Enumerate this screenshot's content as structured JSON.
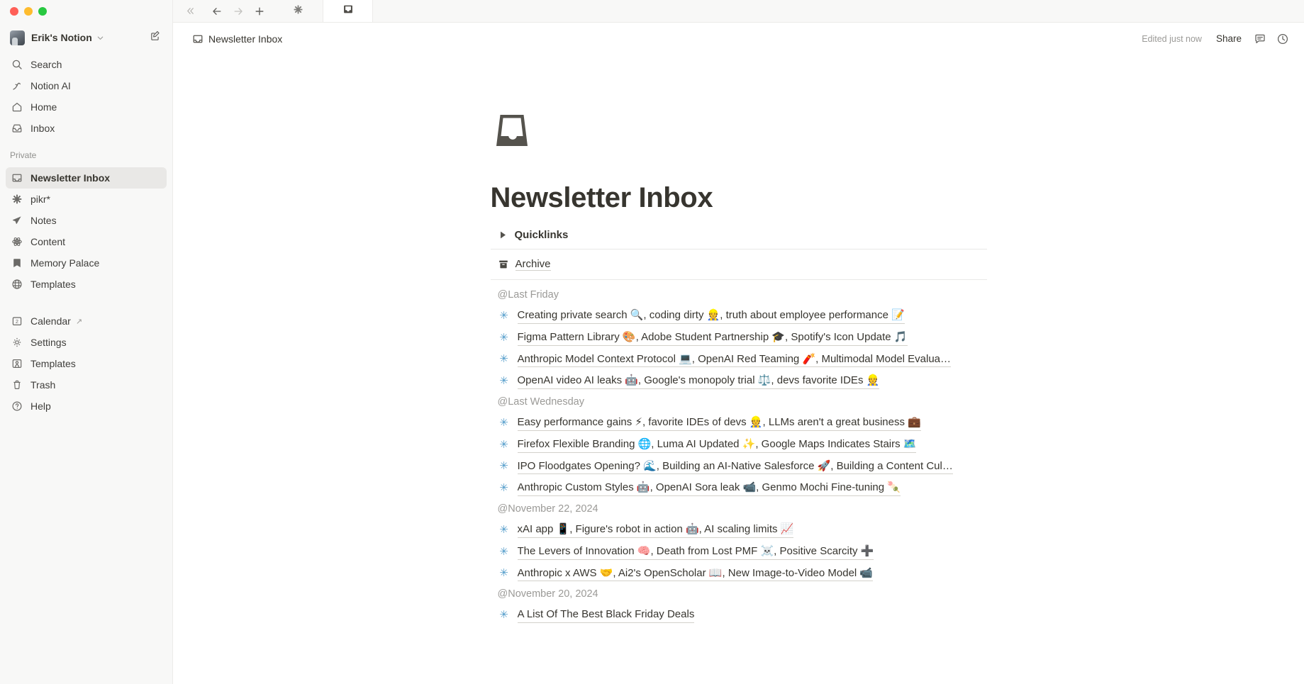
{
  "window": {
    "traffic_lights": [
      "close",
      "minimize",
      "maximize"
    ],
    "colors": {
      "close": "#ff5f57",
      "minimize": "#febc2e",
      "maximize": "#28c840"
    }
  },
  "sidebar": {
    "workspace": {
      "name": "Erik's Notion",
      "chevron": "chevron-down"
    },
    "collapse_label": "«",
    "compose_label": "New page",
    "nav_primary": [
      {
        "label": "Search",
        "icon": "search-icon"
      },
      {
        "label": "Notion AI",
        "icon": "notion-ai-icon"
      },
      {
        "label": "Home",
        "icon": "home-icon"
      },
      {
        "label": "Inbox",
        "icon": "inbox-icon"
      }
    ],
    "private_section_label": "Private",
    "private_items": [
      {
        "label": "Newsletter Inbox",
        "icon": "inbox-tray-icon",
        "active": true
      },
      {
        "label": "pikr*",
        "icon": "asterisk-icon",
        "active": false
      },
      {
        "label": "Notes",
        "icon": "paper-plane-icon",
        "active": false
      },
      {
        "label": "Content",
        "icon": "atom-icon",
        "active": false
      },
      {
        "label": "Memory Palace",
        "icon": "bookmark-icon",
        "active": false
      },
      {
        "label": "Templates",
        "icon": "globe-icon",
        "active": false
      }
    ],
    "nav_footer": [
      {
        "label": "Calendar",
        "icon": "calendar-icon",
        "external": "↗"
      },
      {
        "label": "Settings",
        "icon": "gear-icon",
        "external": ""
      },
      {
        "label": "Templates",
        "icon": "template-icon",
        "external": ""
      },
      {
        "label": "Trash",
        "icon": "trash-icon",
        "external": ""
      },
      {
        "label": "Help",
        "icon": "help-circle-icon",
        "external": ""
      }
    ]
  },
  "tabstrip": {
    "back_label": "←",
    "forward_label": "→",
    "new_tab_label": "+",
    "tabs": [
      {
        "icon": "asterisk-icon",
        "active": false
      },
      {
        "icon": "inbox-tray-icon",
        "active": true
      }
    ]
  },
  "header": {
    "breadcrumb_icon": "inbox-tray-icon",
    "breadcrumb_title": "Newsletter Inbox",
    "edited_status": "Edited just now",
    "share_label": "Share",
    "comment_icon": "comment-icon",
    "history_icon": "clock-icon"
  },
  "page": {
    "icon": "inbox-tray-icon",
    "title": "Newsletter Inbox",
    "toggle": {
      "arrow": "▶",
      "label": "Quicklinks"
    },
    "archive": {
      "icon": "archive-box-icon",
      "label": "Archive"
    },
    "groups": [
      {
        "date": "@Last Friday",
        "items": [
          "Creating private search 🔍, coding dirty 👷, truth about employee performance 📝",
          "Figma Pattern Library 🎨, Adobe Student Partnership 🎓, Spotify's Icon Update 🎵",
          "Anthropic Model Context Protocol 💻, OpenAI Red Teaming 🧨, Multimodal Model Evalua…",
          "OpenAI video AI leaks 🤖, Google's monopoly trial ⚖️, devs favorite IDEs 👷"
        ]
      },
      {
        "date": "@Last Wednesday",
        "items": [
          "Easy performance gains ⚡, favorite IDEs of devs 👷, LLMs aren't a great business 💼",
          "Firefox Flexible Branding 🌐, Luma AI Updated ✨, Google Maps Indicates Stairs 🗺️",
          "IPO Floodgates Opening? 🌊, Building an AI-Native Salesforce 🚀, Building a Content Cul…",
          "Anthropic Custom Styles 🤖, OpenAI Sora leak 📹, Genmo Mochi Fine-tuning 🍡"
        ]
      },
      {
        "date": "@November 22, 2024",
        "items": [
          "xAI app 📱, Figure's robot in action 🤖, AI scaling limits 📈",
          "The Levers of Innovation 🧠, Death from Lost PMF ☠️, Positive Scarcity ➕",
          "Anthropic x AWS 🤝, Ai2's OpenScholar 📖, New Image-to-Video Model 📹"
        ]
      },
      {
        "date": "@November 20, 2024",
        "items": [
          "A List Of The Best Black Friday Deals"
        ]
      }
    ]
  },
  "colors": {
    "sidebar_bg": "#f8f8f7",
    "main_bg": "#ffffff",
    "text": "#37352f",
    "muted": "#9b9a97",
    "accent_star": "#529cca",
    "active_item_bg": "#e9e8e6"
  }
}
